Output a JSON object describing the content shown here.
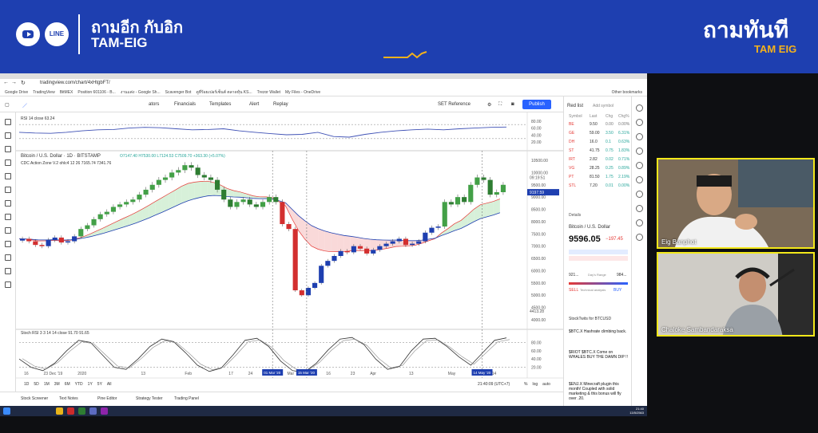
{
  "banner": {
    "title": "ถามอีก กับอิก",
    "subtitle": "TAM-EIG",
    "line_label": "LINE",
    "logo_main": "ถามทันที",
    "logo_sub": "TAM EIG"
  },
  "browser": {
    "url": "tradingview.com/chart/4xHtgbFT/",
    "bookmarks": [
      "Google Drive",
      "TradingView",
      "BitMEX",
      "Position 601106 - B...",
      "งานแต่ง - Google Sh...",
      "Scavenger Bot",
      "ดูที่ร้อยเปอร์เซ็นต์ ตลาดหุ้น KS...",
      "Trezor Wallet",
      "My Files - OneDrive"
    ],
    "other_bookmarks": "Other bookmarks"
  },
  "toolbar": {
    "items": [
      "ators",
      "Financials",
      "Templates",
      "Alert",
      "Replay",
      "SET Reference"
    ],
    "publish": "Publish"
  },
  "chart": {
    "rsi_label": "RSI 14 close 63.24",
    "main_title": "Bitcoin / U.S. Dollar · 1D · BITSTAMP",
    "ohlc": "O7147.40 H7530.00 L7124.53 C7509.70 +363.30 (+5.07%)",
    "indicator": "CDC Action Zone V.2 ohlc4 12 26  7165.74  7341.76",
    "stoch_label": "Stoch RSI 3 3 14 14 close  91.70  91.65",
    "price_axis": [
      "10500.00",
      "10000.00",
      "9500.00",
      "9000.00",
      "8500.00",
      "8000.00",
      "7500.00",
      "7000.00",
      "6500.00",
      "6000.00",
      "5500.00",
      "5000.00",
      "4500.00",
      "4000.00"
    ],
    "price_tag_current": "9197.59",
    "price_tag_high": "09:19:51",
    "price_tag_low": "4413.28",
    "rsi_axis": [
      "80.00",
      "60.00",
      "40.00",
      "20.00"
    ],
    "stoch_axis": [
      "80.00",
      "60.00",
      "40.00",
      "20.00"
    ],
    "time_axis": [
      "16",
      "23 Dec '19",
      "2020",
      "13",
      "Feb",
      "17",
      "24",
      "Mar",
      "16",
      "23",
      "Apr",
      "13",
      "May",
      "14"
    ],
    "time_highlights": [
      "01 Mar '20",
      "15 Mar '20",
      "14 May '20"
    ],
    "timeframes": [
      "1D",
      "5D",
      "1M",
      "3M",
      "6M",
      "YTD",
      "1Y",
      "5Y",
      "All"
    ],
    "clock": "21:40:09 (UTC+7)",
    "scale_opts": [
      "%",
      "log",
      "auto"
    ]
  },
  "chart_data": {
    "type": "candlestick",
    "title": "Bitcoin / U.S. Dollar · 1D · BITSTAMP",
    "ylim": [
      4000,
      10500
    ],
    "close": [
      7300,
      7200,
      7050,
      7000,
      7250,
      7350,
      7150,
      7200,
      7400,
      7700,
      7850,
      8100,
      8300,
      8400,
      8600,
      8700,
      8800,
      8900,
      9100,
      9300,
      9500,
      9700,
      9800,
      10000,
      10100,
      10300,
      10200,
      9900,
      9800,
      9700,
      9300,
      8900,
      8600,
      8800,
      8900,
      8700,
      8600,
      8800,
      9000,
      8800,
      7900,
      7700,
      5200,
      5000,
      5300,
      5500,
      6200,
      6400,
      6600,
      6800,
      6750,
      7000,
      6900,
      6700,
      6850,
      7000,
      7100,
      7200,
      7300,
      7050,
      7100,
      7200,
      7550,
      7750,
      7800,
      8800,
      8700,
      9000,
      8800,
      9500,
      9800,
      9700,
      9100,
      9200,
      9500
    ],
    "rsi": [
      48,
      46,
      45,
      48,
      52,
      55,
      56,
      60,
      62,
      61,
      58,
      55,
      56,
      58,
      52,
      48,
      44,
      41,
      42,
      48,
      36,
      34,
      42,
      48,
      52,
      55,
      57,
      55,
      58,
      60,
      62,
      63
    ],
    "stoch_rsi": [
      40,
      20,
      12,
      30,
      60,
      85,
      80,
      50,
      20,
      15,
      40,
      70,
      88,
      82,
      55,
      25,
      10,
      18,
      50,
      85,
      90,
      70,
      35,
      12,
      8,
      30,
      62,
      88,
      92,
      75,
      40,
      15,
      22,
      60,
      88,
      90,
      70,
      45,
      25,
      55,
      85,
      91
    ]
  },
  "watchlist": {
    "header": "Red list",
    "add_symbol": "Add symbol",
    "columns": [
      "Symbol",
      "Last",
      "Chg",
      "Chg%"
    ],
    "rows": [
      {
        "sym": "BE",
        "last": "9.50",
        "chg": "0.00",
        "pct": "0.00%",
        "color": "#777777"
      },
      {
        "sym": "GE",
        "last": "59.00",
        "chg": "3.50",
        "pct": "6.31%",
        "color": "#26a69a"
      },
      {
        "sym": "DH",
        "last": "16.0",
        "chg": "0.1",
        "pct": "0.63%",
        "color": "#26a69a"
      },
      {
        "sym": "ST",
        "last": "41.75",
        "chg": "0.75",
        "pct": "1.83%",
        "color": "#26a69a"
      },
      {
        "sym": "IRT",
        "last": "2.82",
        "chg": "0.02",
        "pct": "0.71%",
        "color": "#26a69a"
      },
      {
        "sym": "VG",
        "last": "28.25",
        "chg": "0.25",
        "pct": "0.89%",
        "color": "#26a69a"
      },
      {
        "sym": "PT",
        "last": "81.50",
        "chg": "1.75",
        "pct": "2.19%",
        "color": "#26a69a"
      },
      {
        "sym": "STL",
        "last": "7.20",
        "chg": "0.01",
        "pct": "0.00%",
        "color": "#26a69a"
      }
    ],
    "details_header": "Details",
    "det_name": "Bitcoin / U.S. Dollar",
    "det_price": "9596.05",
    "det_change": "−197.45",
    "days_range": "Day's Range",
    "range_low": "921...",
    "range_high": "984...",
    "sell": "SELL",
    "buy": "BUY",
    "tech": "Technical analysis",
    "stocktwits_header": "StockTwits for BTCUSD",
    "posts": [
      "$BTC.X Hashrate climbing back.",
      "$RIOT $BTC.X Come on WHALES BUY THE DAMN DIP !!",
      "$ENJ.X Minecraft plugin this month! Coupled with solid marketing & this bonus will fly over .20."
    ]
  },
  "bottom_tabs": [
    "Stock Screener",
    "Text Notes",
    "Pine Editor",
    "Strategy Tester",
    "Trading Panel"
  ],
  "taskbar": {
    "time": "21:40",
    "date": "13/5/2563"
  },
  "people": [
    {
      "name": "Eig Banphot"
    },
    {
      "name": "Chaloke Sambandaraksa"
    }
  ],
  "colors": {
    "banner": "#1e3fb0",
    "accent": "#f5b21b",
    "up": "#26a69a",
    "down": "#ef5350",
    "frame": "#f3e81a"
  }
}
